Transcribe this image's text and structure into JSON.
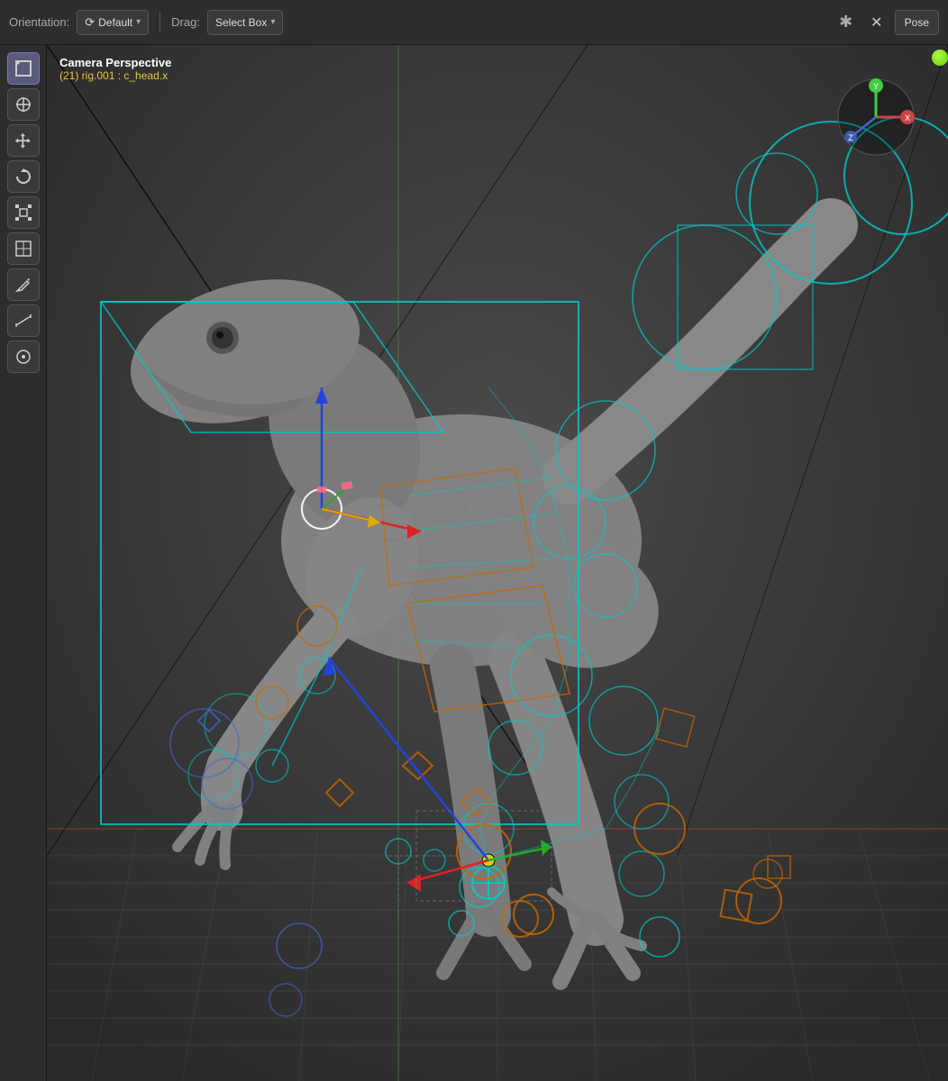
{
  "toolbar": {
    "orientation_label": "Orientation:",
    "orientation_value": "Default",
    "drag_label": "Drag:",
    "drag_value": "Select Box",
    "pose_btn": "Pose",
    "close_icon": "✕"
  },
  "viewport": {
    "camera_title": "Camera Perspective",
    "camera_subtitle": "(21) rig.001 : c_head.x"
  },
  "tools": [
    {
      "name": "select-box",
      "icon": "⬜",
      "active": true
    },
    {
      "name": "cursor",
      "icon": "⊕"
    },
    {
      "name": "move",
      "icon": "✛"
    },
    {
      "name": "rotate",
      "icon": "↻"
    },
    {
      "name": "scale",
      "icon": "⤡"
    },
    {
      "name": "transform",
      "icon": "⊞"
    },
    {
      "name": "annotate",
      "icon": "✏"
    },
    {
      "name": "measure",
      "icon": "📐"
    },
    {
      "name": "extra",
      "icon": "⊙"
    }
  ],
  "colors": {
    "cyan_rig": "#00cccc",
    "orange_rig": "#cc6600",
    "blue_rig": "#4444cc",
    "green_dot": "#88ff00",
    "axis_red": "#cc3333",
    "axis_green": "#33cc33",
    "axis_blue": "#3366ff",
    "transform_red": "#dd2222",
    "transform_green": "#22aa22",
    "transform_blue": "#2244dd",
    "transform_yellow": "#ddcc00",
    "white_circle": "#ffffff"
  }
}
